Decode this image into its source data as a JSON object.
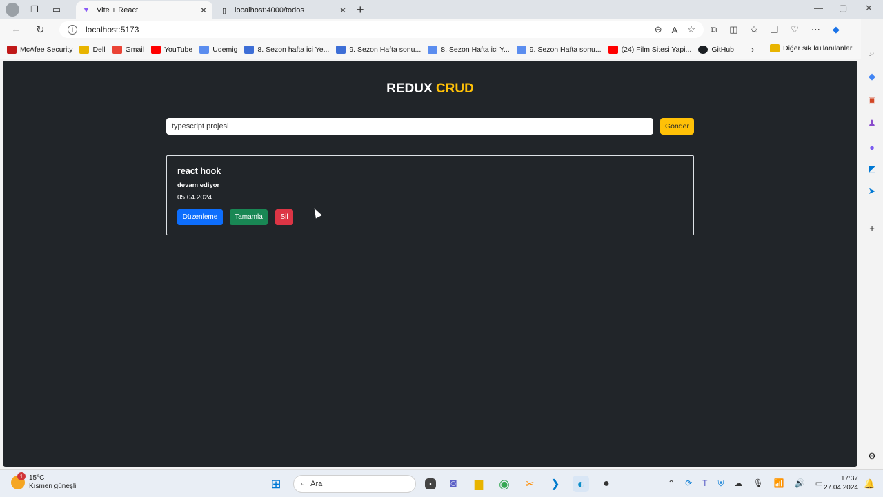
{
  "browser": {
    "tabs": [
      {
        "title": "Vite + React",
        "active": true
      },
      {
        "title": "localhost:4000/todos",
        "active": false
      }
    ],
    "address": "localhost:5173",
    "bookmarks": [
      {
        "label": "McAfee Security",
        "color": "#c01818"
      },
      {
        "label": "Dell",
        "color": "#e8b400"
      },
      {
        "label": "Gmail",
        "color": "#ea4335"
      },
      {
        "label": "YouTube",
        "color": "#ff0000"
      },
      {
        "label": "Udemig",
        "color": "#5b8def"
      },
      {
        "label": "8. Sezon hafta ici Ye...",
        "color": "#3d6ed6"
      },
      {
        "label": "9. Sezon Hafta sonu...",
        "color": "#3d6ed6"
      },
      {
        "label": "8. Sezon Hafta ici Y...",
        "color": "#5b8def"
      },
      {
        "label": "9. Sezon Hafta sonu...",
        "color": "#5b8def"
      },
      {
        "label": "(24) Film Sitesi Yapi...",
        "color": "#ff0000"
      },
      {
        "label": "GitHub",
        "color": "#1b1f23"
      }
    ],
    "other_bookmarks": "Diğer sık kullanılanlar"
  },
  "app": {
    "title_main": "REDUX",
    "title_accent": "CRUD",
    "accent_color": "#ffc107",
    "input_value": "typescript projesi",
    "submit_label": "Gönder",
    "todo": {
      "title": "react hook",
      "status": "devam ediyor",
      "date": "05.04.2024",
      "edit_label": "Düzenleme",
      "complete_label": "Tamamla",
      "delete_label": "Sil"
    },
    "colors": {
      "background": "#212529",
      "edit": "#0d6efd",
      "complete": "#198754",
      "delete": "#dc3545"
    }
  },
  "taskbar": {
    "temperature": "15°C",
    "weather": "Kısmen güneşli",
    "weather_badge": "1",
    "search_placeholder": "Ara",
    "time": "17:37",
    "date": "27.04.2024"
  }
}
